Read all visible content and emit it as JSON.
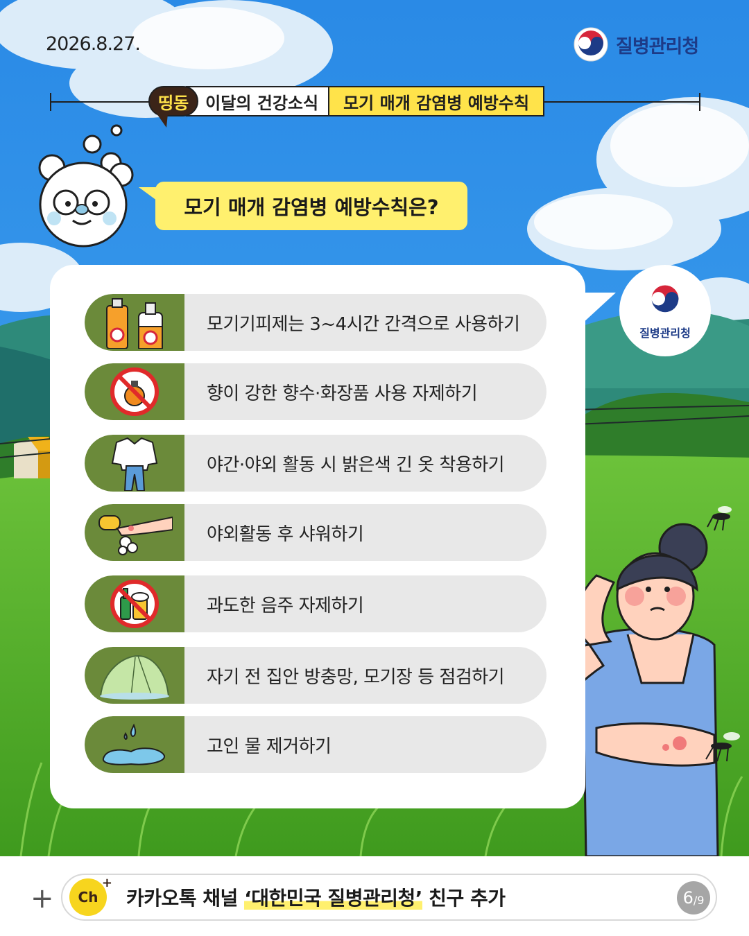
{
  "header": {
    "date": "2026.8.27.",
    "agency_name": "질병관리청"
  },
  "banner": {
    "tag": "띵동",
    "series_title": "이달의 건강소식",
    "topic": "모기 매개 감염병 예방수칙"
  },
  "question": "모기 매개 감염병 예방수칙은?",
  "seal": {
    "label": "질병관리청"
  },
  "rules": [
    {
      "icon": "repellent-spray-icon",
      "text": "모기기피제는 3~4시간 간격으로 사용하기"
    },
    {
      "icon": "no-perfume-icon",
      "text": "향이 강한 향수·화장품 사용 자제하기"
    },
    {
      "icon": "long-clothes-icon",
      "text": "야간·야외 활동 시 밝은색 긴 옷 착용하기"
    },
    {
      "icon": "shower-soap-icon",
      "text": "야외활동 후 샤워하기"
    },
    {
      "icon": "no-alcohol-icon",
      "text": "과도한 음주 자제하기"
    },
    {
      "icon": "mosquito-net-icon",
      "text": "자기 전 집안 방충망, 모기장 등 점검하기"
    },
    {
      "icon": "water-puddle-icon",
      "text": "고인 물 제거하기"
    }
  ],
  "footer": {
    "plus_symbol": "+",
    "channel_badge": "Ch",
    "channel_badge_plus": "+",
    "message_prefix": "카카오톡 채널 ",
    "message_highlight": "‘대한민국 질병관리청’",
    "message_suffix": " 친구 추가",
    "page_current": "6",
    "page_total": "/9"
  },
  "colors": {
    "sky": "#2f8fe8",
    "grass": "#5fb52c",
    "icon_box": "#6b8a3a",
    "highlight_yellow": "#fff06e",
    "agency_navy": "#1d3b87",
    "agency_red": "#d6253a"
  }
}
